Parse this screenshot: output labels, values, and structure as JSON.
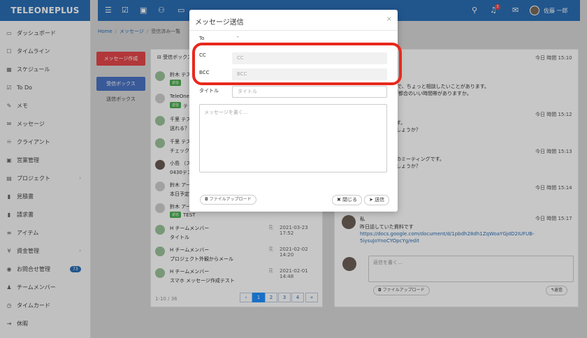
{
  "brand": "TELEONEPLUS",
  "sidebar": {
    "items": [
      {
        "label": "ダッシュボード",
        "icon": "monitor-icon",
        "glyph": "▭"
      },
      {
        "label": "タイムライン",
        "icon": "square-icon",
        "glyph": "☐"
      },
      {
        "label": "スケジュール",
        "icon": "calendar-icon",
        "glyph": "▦"
      },
      {
        "label": "To Do",
        "icon": "checkbox-icon",
        "glyph": "☑"
      },
      {
        "label": "メモ",
        "icon": "edit-icon",
        "glyph": "✎"
      },
      {
        "label": "メッセージ",
        "icon": "envelope-icon",
        "glyph": "✉"
      },
      {
        "label": "クライアント",
        "icon": "handshake-icon",
        "glyph": "♾"
      },
      {
        "label": "営業管理",
        "icon": "box-icon",
        "glyph": "▣"
      },
      {
        "label": "プロジェクト",
        "icon": "briefcase-icon",
        "glyph": "▤"
      },
      {
        "label": "見積書",
        "icon": "document-icon",
        "glyph": "▮"
      },
      {
        "label": "請求書",
        "icon": "document-icon",
        "glyph": "▮"
      },
      {
        "label": "アイテム",
        "icon": "list-icon",
        "glyph": "≡"
      },
      {
        "label": "資金管理",
        "icon": "yen-icon",
        "glyph": "¥"
      },
      {
        "label": "お問合せ管理",
        "icon": "support-icon",
        "glyph": "◉"
      },
      {
        "label": "チームメンバー",
        "icon": "user-icon",
        "glyph": "♟"
      },
      {
        "label": "タイムカード",
        "icon": "clock-icon",
        "glyph": "◷"
      },
      {
        "label": "休暇",
        "icon": "signout-icon",
        "glyph": "⇥"
      }
    ],
    "badge_count": "73"
  },
  "topbar": {
    "user_name": "佐藤 一郎",
    "bell_count": "3"
  },
  "breadcrumb": {
    "home": "Home",
    "section": "メッセージ",
    "current": "受信済み一覧"
  },
  "left_actions": {
    "compose": "メッセージ作成",
    "inbox": "受信ボックス",
    "sent": "送信ボックス"
  },
  "list": {
    "header": "受信ボックス",
    "rows": [
      {
        "from": "鈴木 テス",
        "subject": "",
        "date": "",
        "tag": "返信"
      },
      {
        "from": "TeleOne",
        "subject": "テ",
        "date": "",
        "tag": "返信"
      },
      {
        "from": "千里 テス",
        "subject": "送れる？",
        "date": "",
        "tag": ""
      },
      {
        "from": "千里 テス",
        "subject": "チェック",
        "date": "",
        "tag": ""
      },
      {
        "from": "小島 （ス",
        "subject": "0430テス",
        "date": "",
        "tag": ""
      },
      {
        "from": "鈴木 アー",
        "subject": "本日予定",
        "date": "",
        "tag": ""
      },
      {
        "from": "鈴木 アー",
        "subject": "TEST",
        "date": "",
        "tag": "返信"
      },
      {
        "from": "H チームメンバー",
        "subject": "タイトル",
        "date": "2021-03-23 17:52",
        "tag": ""
      },
      {
        "from": "H チームメンバー",
        "subject": "プロジェクト外観からメール",
        "date": "2021-02-02 14:20",
        "tag": ""
      },
      {
        "from": "H チームメンバー",
        "subject": "スマホ メッセージ作成テスト",
        "date": "2021-02-01 14:48",
        "tag": ""
      }
    ],
    "page_info": "1-10 / 36",
    "pagination": [
      "‹",
      "1",
      "2",
      "3",
      "4",
      "»"
    ]
  },
  "detail": {
    "times": [
      "今日 時間 15:10",
      "今日 時間 15:12",
      "今日 時間 15:13",
      "今日 時間 15:14",
      "今日 時間 15:17"
    ],
    "text1": "で、ちょっと相談したいことがあります。",
    "text2": "ご都合のいい時間帯がありますか。",
    "text3": "す。",
    "text4": "しょうか？",
    "text5": "のミーティングです。",
    "text6": "しょうか？",
    "thread_author": "私",
    "thread_msg_prefix": "昨日話していた資料です",
    "thread_link": "https://docs.google.com/document/d/1pbdh28dh1ZqWoaYGjdD2IUFUB-5iysuJoYnoCYOpcYg/edit",
    "reply_placeholder": "返信を書く...",
    "upload_label": "ファイルアップロード",
    "reply_send": "返信"
  },
  "modal": {
    "title": "メッセージ送信",
    "close_glyph": "×",
    "to_label": "To",
    "to_value": "-",
    "cc_label": "CC",
    "cc_placeholder": "CC",
    "bcc_label": "BCC",
    "bcc_placeholder": "BCC",
    "title_label": "タイトル",
    "title_placeholder": "タイトル",
    "body_placeholder": "メッセージを書く...",
    "upload_label": "ファイルアップロード",
    "close_label": "閉じる",
    "send_label": "送信"
  },
  "colors": {
    "brand_blue": "#2b6fb5",
    "compose_red": "#e5474b",
    "highlight_red": "#e8291c",
    "tag_green": "#4caf50"
  }
}
